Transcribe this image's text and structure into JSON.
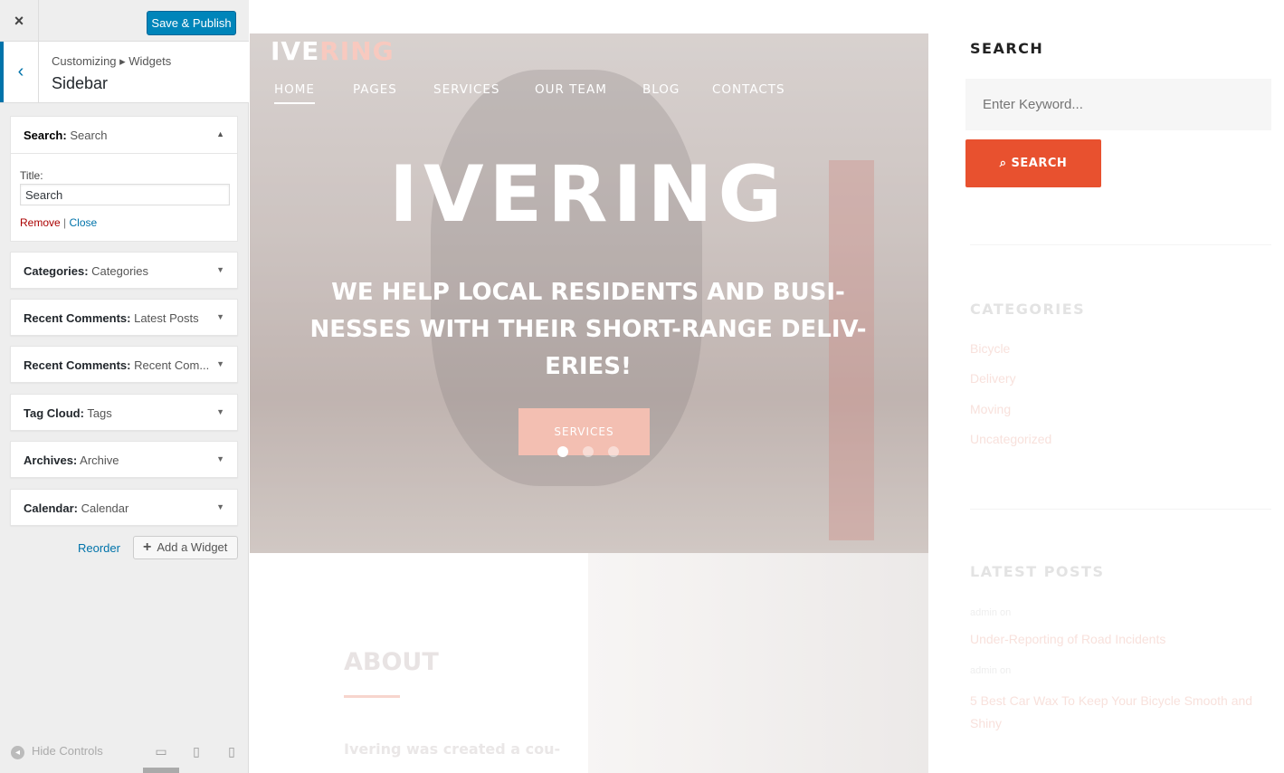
{
  "customizer": {
    "close_label": "×",
    "save_label": "Save & Publish",
    "back_label": "‹",
    "breadcrumb": "Customizing ▸ Widgets",
    "section_title": "Sidebar",
    "widgets": [
      {
        "type": "Search:",
        "title": "Search",
        "open": true
      },
      {
        "type": "Categories:",
        "title": "Categories"
      },
      {
        "type": "Recent Comments:",
        "title": "Latest Posts"
      },
      {
        "type": "Recent Comments:",
        "title": "Recent Com..."
      },
      {
        "type": "Tag Cloud:",
        "title": "Tags"
      },
      {
        "type": "Archives:",
        "title": "Archive"
      },
      {
        "type": "Calendar:",
        "title": "Calendar"
      }
    ],
    "search_widget": {
      "title_label": "Title:",
      "title_value": "Search",
      "remove_label": "Remove",
      "separator": "|",
      "close_label": "Close"
    },
    "reorder_label": "Reorder",
    "add_widget_label": "Add a Widget",
    "hide_controls_label": "Hide Controls",
    "icons": [
      "close-icon",
      "chevron-left-icon",
      "caret-up-icon",
      "caret-down-icon",
      "plus-icon",
      "collapse-icon",
      "desktop-icon",
      "tablet-icon",
      "mobile-icon"
    ]
  },
  "preview": {
    "logo_a": "IVE",
    "logo_b": "RING",
    "nav": [
      "HOME",
      "PAGES",
      "SERVICES",
      "OUR TEAM",
      "BLOG",
      "CONTACTS"
    ],
    "hero_title": "IVERING",
    "hero_subtitle": "WE HELP LOCAL RESIDENTS AND BUSI- NESSES WITH THEIR SHORT-RANGE DELIV- ERIES!",
    "hero_button": "SERVICES",
    "about_title": "ABOUT",
    "about_text": "Ivering was created a cou-",
    "accent_color": "#e8512f"
  },
  "sidebar": {
    "search_title": "SEARCH",
    "search_placeholder": "Enter Keyword...",
    "search_button": "SEARCH",
    "categories_title": "CATEGORIES",
    "categories": [
      "Bicycle",
      "Delivery",
      "Moving",
      "Uncategorized"
    ],
    "latest_title": "LATEST POSTS",
    "posts": [
      {
        "meta": "admin on",
        "title": "Under-Reporting of Road Incidents"
      },
      {
        "meta": "admin on",
        "title": "5 Best Car Wax To Keep Your Bicycle Smooth and Shiny"
      }
    ]
  }
}
